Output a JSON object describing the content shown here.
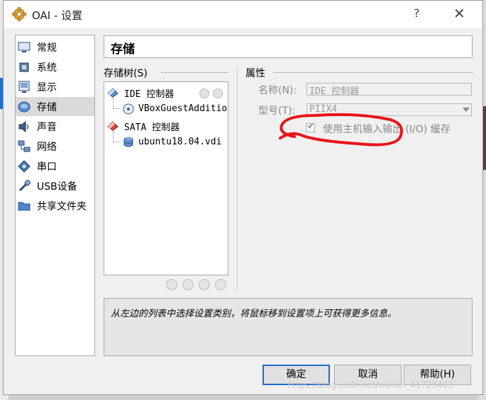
{
  "window": {
    "title": "OAI - 设置",
    "help_label": "?",
    "close_label": "✕"
  },
  "nav": {
    "items": [
      {
        "label": "常规",
        "icon": "monitor-icon",
        "selected": false
      },
      {
        "label": "系统",
        "icon": "chip-icon",
        "selected": false
      },
      {
        "label": "显示",
        "icon": "display-icon",
        "selected": false
      },
      {
        "label": "存储",
        "icon": "disk-icon",
        "selected": true
      },
      {
        "label": "声音",
        "icon": "speaker-icon",
        "selected": false
      },
      {
        "label": "网络",
        "icon": "network-icon",
        "selected": false
      },
      {
        "label": "串口",
        "icon": "serial-port-icon",
        "selected": false
      },
      {
        "label": "USB设备",
        "icon": "usb-icon",
        "selected": false
      },
      {
        "label": "共享文件夹",
        "icon": "folder-icon",
        "selected": false
      }
    ]
  },
  "page": {
    "title": "存储"
  },
  "storage_tree": {
    "label": "存储树(S)",
    "controllers": [
      {
        "label": "IDE 控制器",
        "icon": "ide-controller-icon",
        "devices": [
          {
            "label": "VBoxGuestAdditions.iso",
            "icon": "optical-disc-icon"
          }
        ]
      },
      {
        "label": "SATA 控制器",
        "icon": "sata-controller-icon",
        "devices": [
          {
            "label": "ubuntu18.04.vdi",
            "icon": "hard-disk-icon"
          }
        ]
      }
    ]
  },
  "properties": {
    "label": "属性",
    "name_label": "名称(N):",
    "name_value": "IDE 控制器",
    "type_label": "型号(T):",
    "type_value": "PIIX4",
    "io_cache_label": "使用主机输入输出 (I/O) 缓存",
    "io_cache_checked": true
  },
  "info": {
    "text": "从左边的列表中选择设置类别，将鼠标移到设置项上可获得更多信息。"
  },
  "buttons": {
    "ok": "确定",
    "cancel": "取消",
    "help": "帮助(H)"
  },
  "watermark": "https://blog.csdn.net/weixin_41723423",
  "colors": {
    "accent": "#1c6bd3",
    "annotation": "#e8151b",
    "selection": "#dadada"
  }
}
